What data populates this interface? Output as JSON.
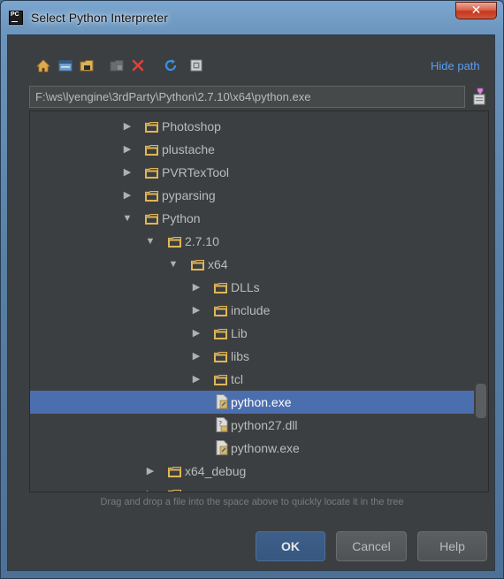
{
  "window": {
    "title": "Select Python Interpreter",
    "app_badge": "PC",
    "close_glyph": "✕"
  },
  "toolbar": {
    "icons": [
      "home-icon",
      "desktop-icon",
      "project-icon",
      "new-folder-icon",
      "delete-icon",
      "refresh-icon",
      "show-hidden-icon"
    ],
    "hide_path_label": "Hide path"
  },
  "path": {
    "value": "F:\\ws\\lyengine\\3rdParty\\Python\\2.7.10\\x64\\python.exe"
  },
  "tree": {
    "items": [
      {
        "label": "Photoshop",
        "type": "folder",
        "expanded": false,
        "level": 0
      },
      {
        "label": "plustache",
        "type": "folder",
        "expanded": false,
        "level": 0
      },
      {
        "label": "PVRTexTool",
        "type": "folder",
        "expanded": false,
        "level": 0
      },
      {
        "label": "pyparsing",
        "type": "folder",
        "expanded": false,
        "level": 0
      },
      {
        "label": "Python",
        "type": "folder",
        "expanded": true,
        "level": 0
      },
      {
        "label": "2.7.10",
        "type": "folder",
        "expanded": true,
        "level": 1
      },
      {
        "label": "x64",
        "type": "folder",
        "expanded": true,
        "level": 2
      },
      {
        "label": "DLLs",
        "type": "folder",
        "expanded": false,
        "level": 3
      },
      {
        "label": "include",
        "type": "folder",
        "expanded": false,
        "level": 3
      },
      {
        "label": "Lib",
        "type": "folder",
        "expanded": false,
        "level": 3
      },
      {
        "label": "libs",
        "type": "folder",
        "expanded": false,
        "level": 3
      },
      {
        "label": "tcl",
        "type": "folder",
        "expanded": false,
        "level": 3
      },
      {
        "label": "python.exe",
        "type": "file",
        "selected": true,
        "level": 3
      },
      {
        "label": "python27.dll",
        "type": "file-unknown",
        "level": 3
      },
      {
        "label": "pythonw.exe",
        "type": "file",
        "level": 3
      },
      {
        "label": "x64_debug",
        "type": "folder",
        "expanded": false,
        "level": 1
      },
      {
        "label": "",
        "type": "folder",
        "expanded": false,
        "level": 1
      }
    ]
  },
  "hint": "Drag and drop a file into the space above to quickly locate it in the tree",
  "buttons": {
    "ok": "OK",
    "cancel": "Cancel",
    "help": "Help"
  },
  "colors": {
    "selection": "#4b6eaf",
    "link": "#589df6",
    "folder": "#e0b657",
    "delete": "#e0403a"
  }
}
